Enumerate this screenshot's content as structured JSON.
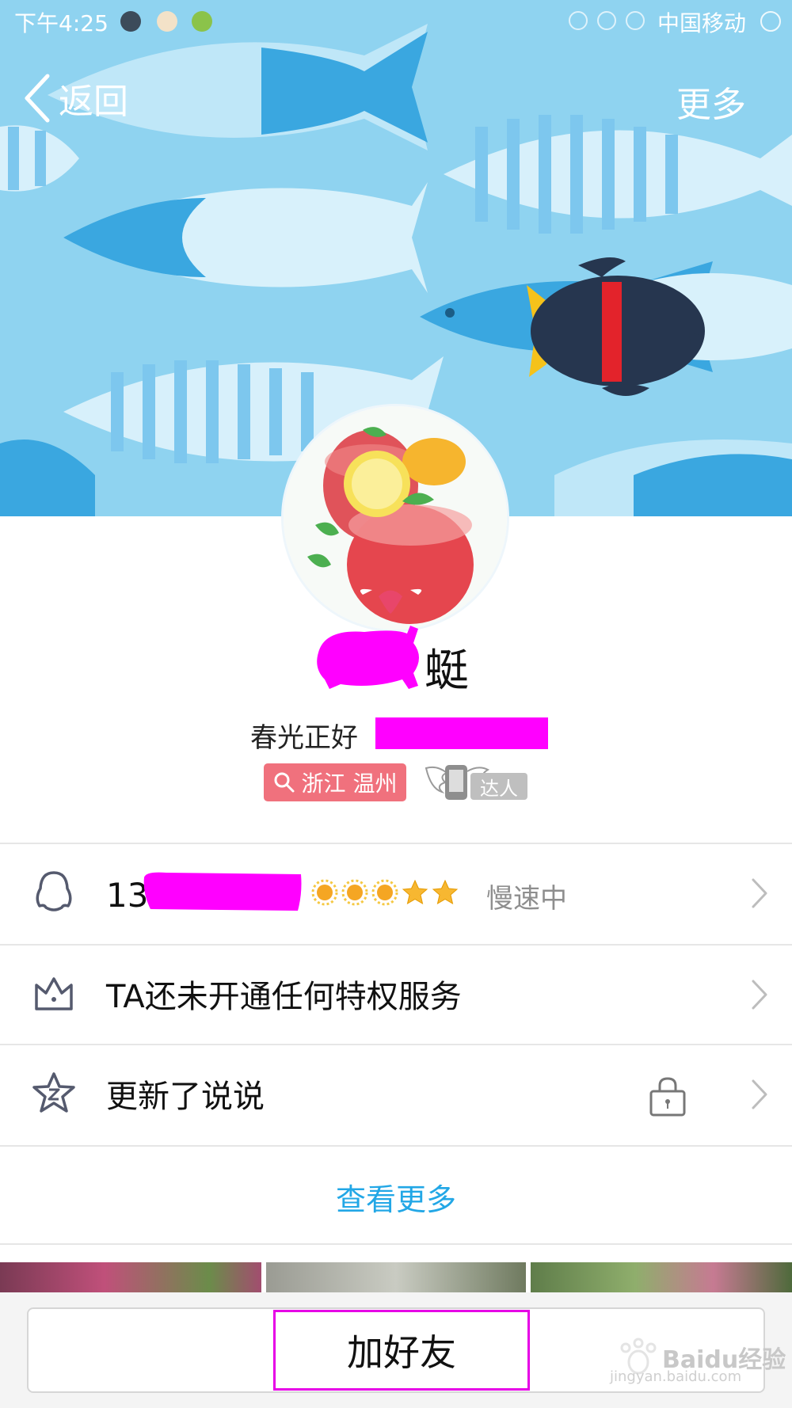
{
  "status_bar": {
    "time": "下午4:25",
    "carrier": "中国移动"
  },
  "nav": {
    "back_label": "返回",
    "more_label": "更多"
  },
  "profile": {
    "name_visible_char": "蜓",
    "signature": "春光正好",
    "location": "浙江 温州",
    "badge_label": "达人"
  },
  "rows": {
    "qq": {
      "number_prefix": "13",
      "level_suns": 3,
      "level_stars": 2,
      "status": "慢速中"
    },
    "privilege": {
      "text": "TA还未开通任何特权服务"
    },
    "feed": {
      "text": "更新了说说"
    }
  },
  "view_more": "查看更多",
  "add_friend": "加好友",
  "watermark": {
    "brand": "Baidu经验",
    "url": "jingyan.baidu.com"
  },
  "colors": {
    "accent_link": "#22a7e6",
    "location_badge": "#f0717d",
    "redaction": "#ff00ff",
    "banner_bg": "#8fd3f0"
  },
  "icons": {
    "back": "chevron-left-icon",
    "qq": "penguin-icon",
    "privilege": "crown-icon",
    "feed": "star-z-icon",
    "lock": "lock-icon",
    "chevron": "chevron-right-icon"
  }
}
